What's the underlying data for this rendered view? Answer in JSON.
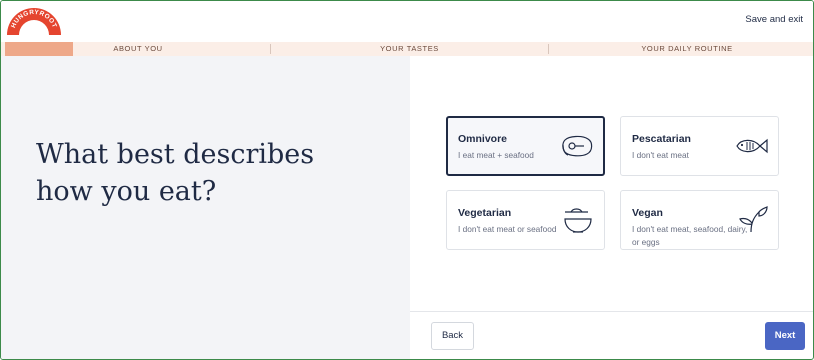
{
  "header": {
    "logo_text": "HUNGRYROOT",
    "save_exit_label": "Save and exit"
  },
  "progress": {
    "steps": [
      "ABOUT YOU",
      "YOUR TASTES",
      "YOUR DAILY ROUTINE"
    ],
    "current_step": 1,
    "fill_fraction_of_first_step": 0.25,
    "colors": {
      "fill": "#eea889",
      "track": "#fbeee7"
    }
  },
  "question": {
    "line1": "What best describes",
    "line2": "how you eat?"
  },
  "options": [
    {
      "title": "Omnivore",
      "subtitle": "I eat meat + seafood",
      "icon": "steak-icon",
      "selected": true
    },
    {
      "title": "Pescatarian",
      "subtitle": "I don't eat meat",
      "icon": "fish-icon",
      "selected": false
    },
    {
      "title": "Vegetarian",
      "subtitle": "I don't eat meat or seafood",
      "icon": "bowl-icon",
      "selected": false
    },
    {
      "title": "Vegan",
      "subtitle": "I don't eat meat, seafood, dairy, or eggs",
      "icon": "sprout-icon",
      "selected": false
    }
  ],
  "footer": {
    "back_label": "Back",
    "next_label": "Next"
  },
  "colors": {
    "accent": "#4a66c4",
    "text_dark": "#1f2a44",
    "logo_red": "#e5452f"
  }
}
